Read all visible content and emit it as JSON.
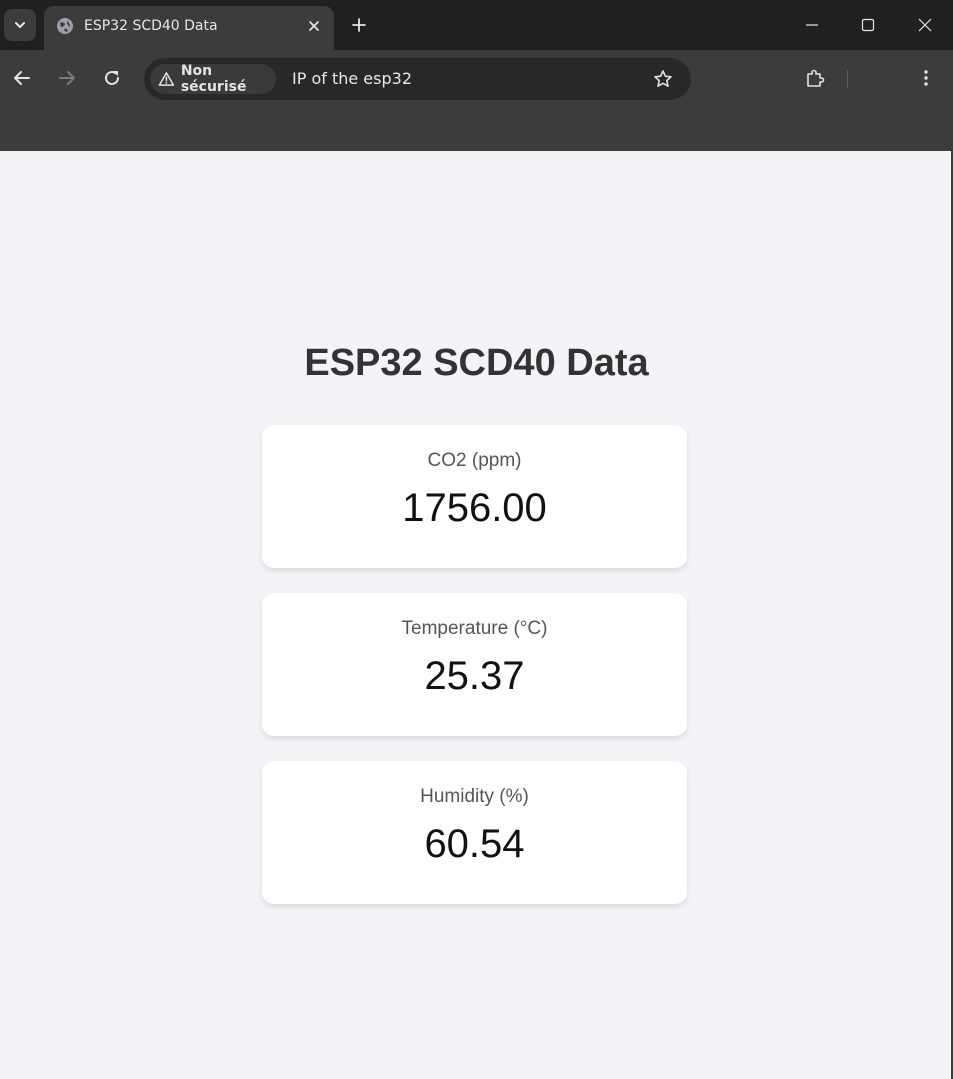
{
  "browser": {
    "tab_title": "ESP32 SCD40 Data",
    "security_label": "Non sécurisé",
    "url": "IP of the esp32",
    "icons": {
      "tab_search": "chevron-down-icon",
      "favicon": "globe-icon",
      "tab_close": "close-icon",
      "new_tab": "plus-icon",
      "minimize": "minimize-icon",
      "maximize": "maximize-icon",
      "close_window": "close-icon",
      "back": "arrow-left-icon",
      "forward": "arrow-right-icon",
      "reload": "reload-icon",
      "warning": "warning-icon",
      "bookmark": "star-icon",
      "extensions": "puzzle-icon",
      "menu": "kebab-menu-icon"
    }
  },
  "page": {
    "title": "ESP32 SCD40 Data",
    "cards": [
      {
        "label": "CO2 (ppm)",
        "value": "1756.00"
      },
      {
        "label": "Temperature (°C)",
        "value": "25.37"
      },
      {
        "label": "Humidity (%)",
        "value": "60.54"
      }
    ]
  },
  "colors": {
    "page_background": "#f4f4f8",
    "card_background": "#ffffff",
    "title_color": "#333333",
    "chrome_dark": "#202020",
    "chrome_toolbar": "#3c3c3c"
  }
}
